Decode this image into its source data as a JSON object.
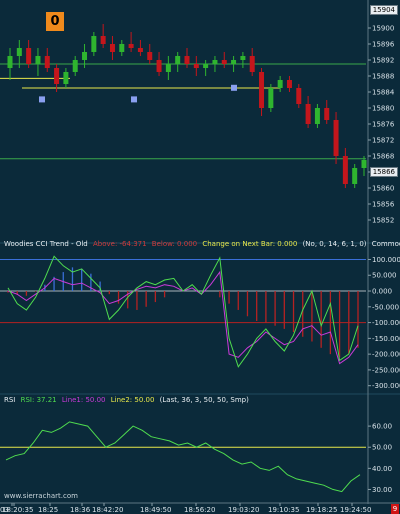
{
  "chart_data": [
    {
      "type": "candlestick",
      "title": "",
      "ylim": [
        15848,
        15906
      ],
      "y_ticks": [
        15900,
        15896,
        15892,
        15888,
        15884,
        15880,
        15876,
        15872,
        15868,
        15864,
        15860,
        15856,
        15852
      ],
      "y_tick_labels": [
        "15900",
        "15896",
        "15892",
        "15888",
        "15884",
        "15880",
        "15876",
        "15872",
        "15868",
        "15864",
        "15860",
        "15856",
        "15852"
      ],
      "last_price_label": "15866",
      "top_label": "15904",
      "marker_label": "0",
      "horizontal_lines_y": [
        15891.0,
        15887.4,
        15885.0,
        15867.3
      ],
      "square_markers": [
        [
          15884.4,
          "l"
        ],
        [
          15884.4,
          "m"
        ],
        [
          15887.3,
          "r"
        ]
      ],
      "candles": [
        [
          15890,
          15895,
          15887,
          15893
        ],
        [
          15893,
          15897,
          15890,
          15895
        ],
        [
          15895,
          15897,
          15890,
          15891
        ],
        [
          15891,
          15895,
          15888,
          15893
        ],
        [
          15893,
          15895,
          15889,
          15890
        ],
        [
          15890,
          15891,
          15884,
          15886
        ],
        [
          15886,
          15890,
          15885,
          15889
        ],
        [
          15889,
          15893,
          15888,
          15892
        ],
        [
          15892,
          15896,
          15890,
          15894
        ],
        [
          15894,
          15899,
          15893,
          15898
        ],
        [
          15898,
          15901,
          15895,
          15896
        ],
        [
          15896,
          15898,
          15892,
          15894
        ],
        [
          15894,
          15897,
          15893,
          15896
        ],
        [
          15896,
          15899,
          15894,
          15895
        ],
        [
          15895,
          15897,
          15893,
          15894
        ],
        [
          15894,
          15896,
          15891,
          15892
        ],
        [
          15892,
          15894,
          15888,
          15889
        ],
        [
          15889,
          15893,
          15887,
          15891
        ],
        [
          15891,
          15894,
          15889,
          15893
        ],
        [
          15893,
          15895,
          15890,
          15891
        ],
        [
          15891,
          15893,
          15888,
          15890
        ],
        [
          15890,
          15892,
          15888,
          15891
        ],
        [
          15891,
          15893,
          15889,
          15892
        ],
        [
          15892,
          15894,
          15890,
          15891
        ],
        [
          15891,
          15893,
          15889,
          15892
        ],
        [
          15892,
          15894,
          15890,
          15893
        ],
        [
          15893,
          15895,
          15888,
          15889
        ],
        [
          15889,
          15890,
          15878,
          15880
        ],
        [
          15880,
          15886,
          15879,
          15885
        ],
        [
          15885,
          15888,
          15884,
          15887
        ],
        [
          15887,
          15888,
          15884,
          15885
        ],
        [
          15885,
          15886,
          15880,
          15881
        ],
        [
          15881,
          15883,
          15875,
          15876
        ],
        [
          15876,
          15881,
          15875,
          15880
        ],
        [
          15880,
          15882,
          15876,
          15877
        ],
        [
          15877,
          15879,
          15866,
          15868
        ],
        [
          15868,
          15870,
          15860,
          15861
        ],
        [
          15861,
          15866,
          15860,
          15865
        ],
        [
          15865,
          15868,
          15863,
          15867
        ]
      ]
    },
    {
      "type": "bar-line",
      "title": "Woodies CCI Trend - Old",
      "ylim": [
        -320,
        130
      ],
      "y_ticks": [
        100,
        50,
        0,
        -50,
        -100,
        -150,
        -200,
        -250,
        -300
      ],
      "y_tick_labels": [
        "100.000",
        "50.000",
        "0.000",
        "-50.000",
        "-100.000",
        "-150.000",
        "-200.000",
        "-250.000",
        "-300.000"
      ],
      "header_labels": {
        "above": "Above: -64.371",
        "below": "Below: 0.000",
        "change": "Change on Next Bar: 0.000",
        "params": "(No, 0, 14, 6, 1, 0)",
        "extra": "Commod"
      },
      "level_lines": [
        100,
        0,
        -100
      ],
      "histogram": [
        -5,
        -12,
        -15,
        -2,
        20,
        45,
        60,
        75,
        70,
        55,
        30,
        -10,
        -40,
        -55,
        -60,
        -50,
        -35,
        -20,
        0,
        0,
        0,
        0,
        0,
        -20,
        -40,
        -60,
        -80,
        -95,
        -100,
        -110,
        -120,
        -130,
        -145,
        -160,
        -180,
        -200,
        -210,
        -200,
        -180
      ],
      "green_line": [
        10,
        -40,
        -60,
        -20,
        40,
        110,
        80,
        60,
        70,
        40,
        10,
        -90,
        -60,
        -20,
        10,
        30,
        20,
        35,
        40,
        0,
        20,
        -10,
        50,
        105,
        -150,
        -240,
        -200,
        -150,
        -120,
        -160,
        -190,
        -140,
        -60,
        0,
        -110,
        -40,
        -220,
        -200,
        -110
      ],
      "magenta_line": [
        0,
        -10,
        -30,
        -10,
        10,
        40,
        30,
        20,
        25,
        10,
        -5,
        -40,
        -30,
        -10,
        5,
        15,
        10,
        20,
        15,
        0,
        10,
        -10,
        20,
        60,
        -200,
        -210,
        -180,
        -160,
        -130,
        -150,
        -170,
        -160,
        -120,
        -110,
        -140,
        -130,
        -230,
        -210,
        -170
      ]
    },
    {
      "type": "line",
      "title": "RSI",
      "ylim": [
        25,
        70
      ],
      "y_ticks": [
        60,
        50,
        40,
        30
      ],
      "y_tick_labels": [
        "60.00",
        "50.00",
        "40.00",
        "30.00"
      ],
      "header_labels": {
        "name": "RSI",
        "rsi": "RSI: 37.21",
        "line1": "Line1: 50.00",
        "line2": "Line2: 50.00",
        "params": "(Last, 36, 3, 50, 50, Smp)"
      },
      "level_lines": [
        50
      ],
      "values": [
        44,
        46,
        47,
        52,
        58,
        57,
        59,
        62,
        61,
        60,
        55,
        50,
        52,
        56,
        60,
        58,
        55,
        54,
        53,
        51,
        52,
        50,
        52,
        49,
        47,
        44,
        42,
        43,
        40,
        39,
        41,
        37,
        35,
        34,
        33,
        32,
        30,
        29,
        34,
        37
      ]
    }
  ],
  "x_axis": {
    "labels": [
      "03",
      "18:20:35",
      "18:25",
      "18:36",
      "18:42:20",
      "18:49:50",
      "18:56:20",
      "19:03:20",
      "19:10:35",
      "19:18:25",
      "19:24:50"
    ],
    "watermark": "www.sierrachart.com",
    "corner_badge": "9"
  },
  "colors": {
    "background": "#0b2a3a",
    "up_candle": "#2fb52f",
    "down_candle": "#c4161c",
    "green_line": "#4fdc4f",
    "magenta_line": "#c93ad8",
    "yellow_line": "#e8e84a",
    "blue_line": "#3a6fd8",
    "red_line": "#b52222",
    "square_marker": "#8aa0f0"
  }
}
